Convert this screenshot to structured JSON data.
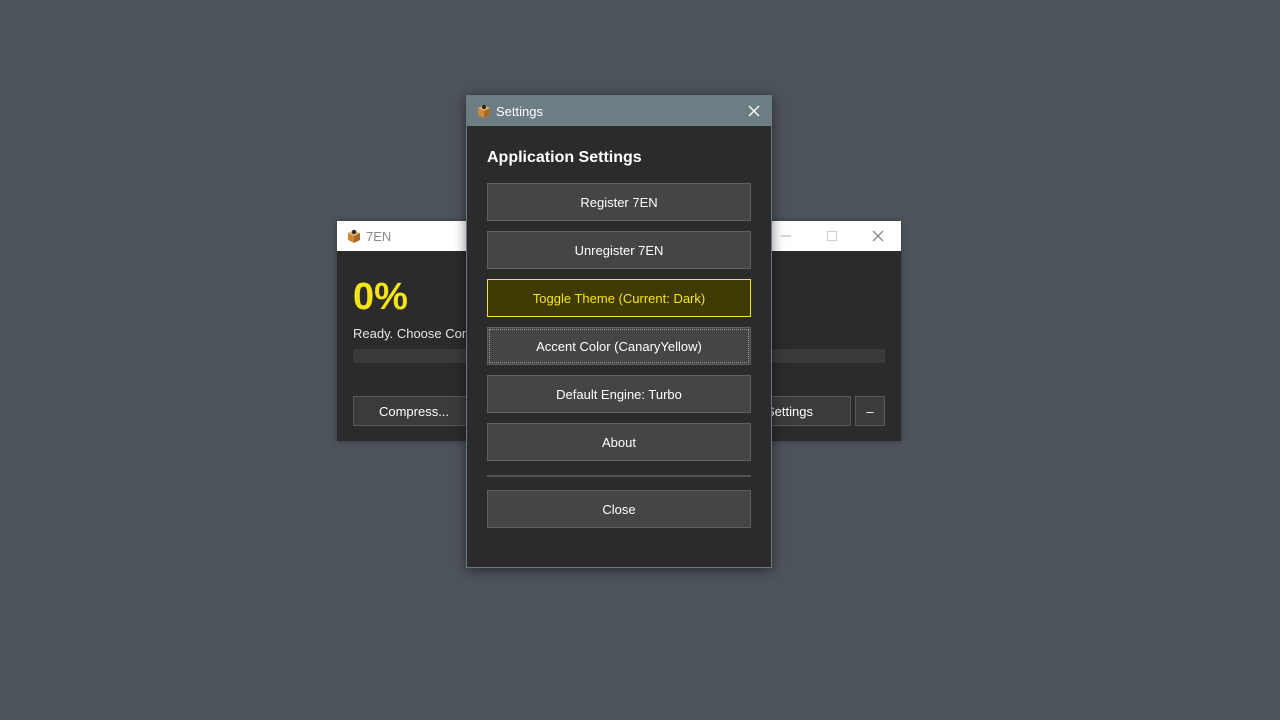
{
  "main_window": {
    "title": "7EN",
    "percent": "0%",
    "progress_percent": 0,
    "status": "Ready. Choose Com",
    "compress_label": "Compress...",
    "settings_label": "Settings",
    "more_label": "–"
  },
  "settings_dialog": {
    "title": "Settings",
    "heading": "Application Settings",
    "buttons": [
      {
        "label": "Register 7EN"
      },
      {
        "label": "Unregister 7EN"
      },
      {
        "label": "Toggle Theme (Current: Dark)"
      },
      {
        "label": "Accent Color (CanaryYellow)"
      },
      {
        "label": "Default Engine: Turbo"
      },
      {
        "label": "About"
      }
    ],
    "close_label": "Close"
  },
  "colors": {
    "accent": "#f5e514",
    "background": "#4e545b",
    "window_bg": "#2b2b2d",
    "dialog_titlebar": "#6c7d83"
  },
  "icons": {
    "app": "app-box-icon",
    "close": "close-icon",
    "minimize": "minimize-icon",
    "maximize": "maximize-icon"
  }
}
